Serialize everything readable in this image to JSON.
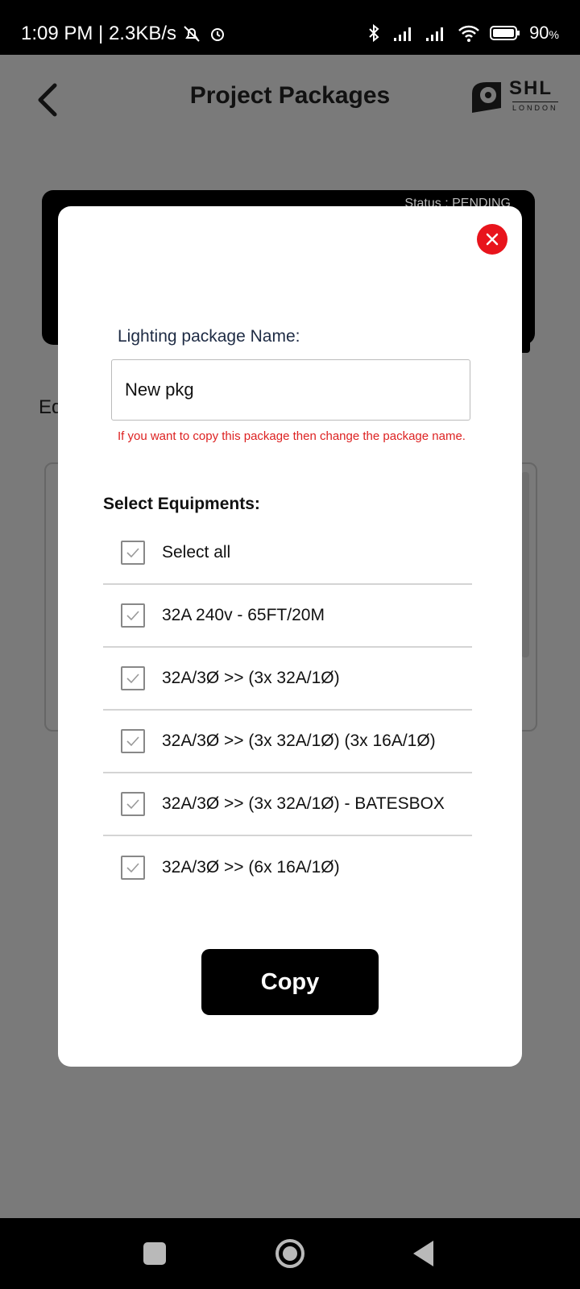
{
  "status_bar": {
    "time_speed": "1:09 PM | 2.3KB/s",
    "battery": "90",
    "battery_unit": "%"
  },
  "header": {
    "title": "Project Packages",
    "logo_text": "SHL",
    "logo_sub": "LONDON"
  },
  "background": {
    "status_partial": "Status : PENDING",
    "section_partial": "Eq"
  },
  "modal": {
    "name_label": "Lighting package Name:",
    "name_value": "New pkg",
    "name_placeholder": "",
    "hint": "If you want to copy this package then change the package name.",
    "section_title": "Select Equipments:",
    "items": [
      {
        "label": "Select all",
        "checked": true
      },
      {
        "label": "32A 240v - 65FT/20M",
        "checked": true
      },
      {
        "label": "32A/3Ø >> (3x 32A/1Ø)",
        "checked": true
      },
      {
        "label": "32A/3Ø >> (3x 32A/1Ø) (3x 16A/1Ø)",
        "checked": true
      },
      {
        "label": "32A/3Ø >> (3x 32A/1Ø) - BATESBOX",
        "checked": true
      },
      {
        "label": "32A/3Ø >> (6x 16A/1Ø)",
        "checked": true
      }
    ],
    "copy_label": "Copy"
  },
  "colors": {
    "close": "#e8141c",
    "hint": "#dd2222",
    "overlay": "#7a7a7a"
  }
}
